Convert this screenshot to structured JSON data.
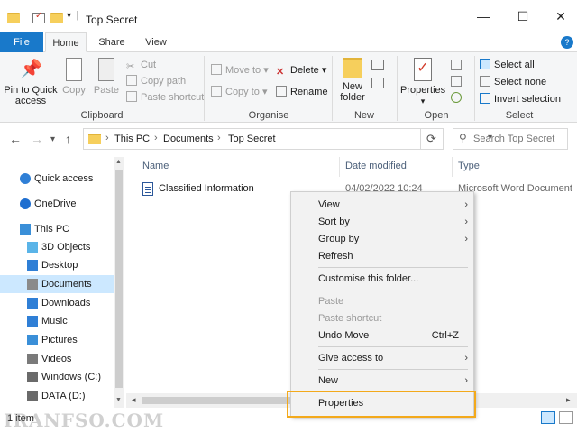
{
  "window": {
    "title": "Top Secret",
    "minimize": "—",
    "maximize": "☐",
    "close": "✕"
  },
  "ribbon_tabs": [
    "File",
    "Home",
    "Share",
    "View"
  ],
  "ribbon": {
    "clipboard": {
      "pin": "Pin to Quick access",
      "copy": "Copy",
      "paste": "Paste",
      "cut": "Cut",
      "copy_path": "Copy path",
      "paste_shortcut": "Paste shortcut",
      "label": "Clipboard"
    },
    "organise": {
      "move_to": "Move to",
      "copy_to": "Copy to",
      "delete": "Delete",
      "rename": "Rename",
      "label": "Organise"
    },
    "new": {
      "new_folder": "New folder",
      "label": "New"
    },
    "open": {
      "properties": "Properties",
      "label": "Open"
    },
    "select": {
      "select_all": "Select all",
      "select_none": "Select none",
      "invert": "Invert selection",
      "label": "Select"
    }
  },
  "address": {
    "crumbs": [
      "This PC",
      "Documents",
      "Top Secret"
    ],
    "search_placeholder": "Search Top Secret"
  },
  "nav": {
    "items": [
      {
        "label": "Quick access",
        "icon": "star-icon",
        "color": "#2f7fd6"
      },
      {
        "label": "OneDrive",
        "icon": "cloud-icon",
        "color": "#1f6fd0"
      },
      {
        "label": "This PC",
        "icon": "monitor-icon",
        "color": "#3a8fd8"
      },
      {
        "label": "3D Objects",
        "icon": "cube-icon",
        "color": "#5ab4e8"
      },
      {
        "label": "Desktop",
        "icon": "desktop-icon",
        "color": "#2f7fd6"
      },
      {
        "label": "Documents",
        "icon": "document-icon",
        "color": "#8a8a8a"
      },
      {
        "label": "Downloads",
        "icon": "download-icon",
        "color": "#2f7fd6"
      },
      {
        "label": "Music",
        "icon": "music-icon",
        "color": "#2f7fd6"
      },
      {
        "label": "Pictures",
        "icon": "pictures-icon",
        "color": "#3a8fd8"
      },
      {
        "label": "Videos",
        "icon": "video-icon",
        "color": "#7a7a7a"
      },
      {
        "label": "Windows (C:)",
        "icon": "drive-icon",
        "color": "#6a6a6a"
      },
      {
        "label": "DATA (D:)",
        "icon": "drive-icon",
        "color": "#6a6a6a"
      }
    ]
  },
  "columns": {
    "name": "Name",
    "date": "Date modified",
    "type": "Type"
  },
  "file": {
    "name": "Classified Information",
    "date": "04/02/2022 10:24",
    "type": "Microsoft Word Document"
  },
  "context_menu": {
    "view": "View",
    "sort_by": "Sort by",
    "group_by": "Group by",
    "refresh": "Refresh",
    "customise": "Customise this folder...",
    "paste": "Paste",
    "paste_shortcut": "Paste shortcut",
    "undo_move": "Undo Move",
    "undo_shortcut": "Ctrl+Z",
    "give_access": "Give access to",
    "new": "New",
    "properties": "Properties"
  },
  "status": {
    "count": "1 item"
  },
  "watermark": "IRANFSO.COM",
  "colors": {
    "accent": "#1979ca",
    "selection": "#cce8ff",
    "highlight": "#f3a91b"
  }
}
